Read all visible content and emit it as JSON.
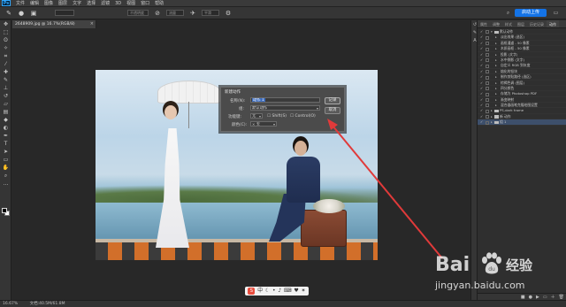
{
  "app": {
    "logo": "Ps",
    "menu": [
      "文件",
      "编辑",
      "图像",
      "图层",
      "文字",
      "选择",
      "滤镜",
      "3D",
      "视图",
      "窗口",
      "帮助"
    ],
    "share_label": "启动上传"
  },
  "options": {
    "fields": [
      "不透明度",
      "流量",
      "平滑"
    ]
  },
  "document": {
    "tab_label": "2648909.jpg @ 16.7%(RGB/8)",
    "close_glyph": "×",
    "zoom": "16.67%",
    "status": "文档:40.5M/61.8M"
  },
  "dialog": {
    "title": "新建动作",
    "name_label": "名称(N):",
    "name_value": "动作 1",
    "set_label": "组:",
    "set_value": "默认动作",
    "fkey_label": "功能键:",
    "fkey_value": "无",
    "shift_label": "Shift(S)",
    "ctrl_label": "Control(O)",
    "color_label": "颜色(C):",
    "color_value": "无",
    "record_button": "记录",
    "cancel_button": "取消"
  },
  "panel": {
    "tabs": [
      "属性",
      "调整",
      "样式",
      "图层",
      "历史记录",
      "动作"
    ],
    "active_tab": "动作",
    "actions": [
      {
        "label": "默认动作",
        "type": "folder",
        "expanded": true
      },
      {
        "label": "淡出效果 (选区)",
        "type": "item"
      },
      {
        "label": "画框通道 - 50 像素",
        "type": "item"
      },
      {
        "label": "木质画框 - 50 像素",
        "type": "item"
      },
      {
        "label": "投影 (文字)",
        "type": "item"
      },
      {
        "label": "水中倒影 (文字)",
        "type": "item"
      },
      {
        "label": "自定义 RGB 到灰度",
        "type": "item"
      },
      {
        "label": "熔化的铅块",
        "type": "item"
      },
      {
        "label": "制作剪贴路径 (选区)",
        "type": "item"
      },
      {
        "label": "棕褐色调 (图层)",
        "type": "item"
      },
      {
        "label": "四分颜色",
        "type": "item"
      },
      {
        "label": "存储为 Photoshop PDF",
        "type": "item"
      },
      {
        "label": "渐变映射",
        "type": "item"
      },
      {
        "label": "混合器画笔克隆绘图设置",
        "type": "item"
      },
      {
        "label": "PS-dark frame",
        "type": "folder",
        "expanded": false
      },
      {
        "label": "新 动作",
        "type": "folder",
        "expanded": false
      },
      {
        "label": "组 1",
        "type": "folder",
        "expanded": false,
        "selected": true
      }
    ]
  },
  "watermark": {
    "brand_text": "Bai",
    "brand_suffix": "经验",
    "url": "jingyan.baidu.com",
    "paw_label": "du"
  },
  "colors": {
    "accent": "#1473e6",
    "arrow": "#e03a3a"
  }
}
